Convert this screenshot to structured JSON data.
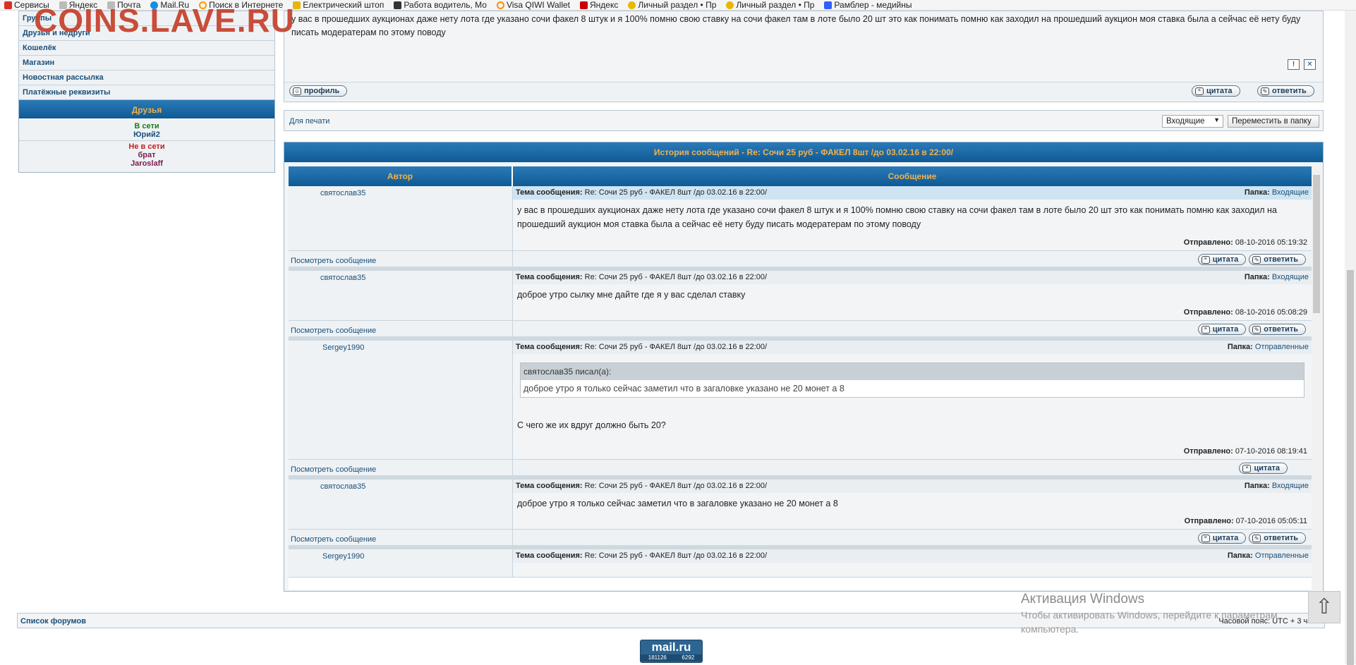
{
  "bookmarks": [
    {
      "label": "Сервисы",
      "icon": "apps-grid-icon",
      "color": "#d93025"
    },
    {
      "label": "Яндекс",
      "icon": "page-icon",
      "color": "#bbbbbb"
    },
    {
      "label": "Почта",
      "icon": "page-icon",
      "color": "#bbbbbb"
    },
    {
      "label": "Mail.Ru",
      "icon": "mailru-icon",
      "color": "#168de2"
    },
    {
      "label": "Поиск в Интернете",
      "icon": "search-icon",
      "color": "#ff9900"
    },
    {
      "label": "Електрический штоп",
      "icon": "bookmark-icon",
      "color": "#e3b70c"
    },
    {
      "label": "Работа водитель, Мо",
      "icon": "rn-icon",
      "color": "#333333"
    },
    {
      "label": "Visa QIWI Wallet",
      "icon": "qiwi-icon",
      "color": "#ff8c00"
    },
    {
      "label": "Яндекс",
      "icon": "yandex-icon",
      "color": "#cc0000"
    },
    {
      "label": "Личный раздел • Пр",
      "icon": "smiley-icon",
      "color": "#e6b800"
    },
    {
      "label": "Личный раздел • Пр",
      "icon": "smiley-icon",
      "color": "#e6b800"
    },
    {
      "label": "Рамблер - медийны",
      "icon": "rambler-icon",
      "color": "#315efb"
    }
  ],
  "watermark": "COINS.LAVE.RU",
  "sidebar": {
    "items": [
      "Группы",
      "Друзья и недруги",
      "Кошелёк",
      "Магазин",
      "Новостная рассылка",
      "Платёжные реквизиты"
    ]
  },
  "friends": {
    "title": "Друзья",
    "online_label": "В сети",
    "online": [
      "Юрий2"
    ],
    "offline_label": "Не в сети",
    "offline": [
      "брат",
      "Jaroslaff"
    ]
  },
  "top_message": {
    "text": "у вас в прошедших аукционах даже нету лота где указано сочи факел 8 штук и я 100% помню свою ставку на сочи факел там в лоте было 20 шт это как понимать помню как заходил на прошедший аукцион моя ставка была а сейчас её нету буду писать модератерам по этому поводу",
    "report_icon": "!",
    "delete_icon": "✕",
    "profile_label": "профиль",
    "quote_label": "цитата",
    "reply_label": "ответить"
  },
  "printbar": {
    "print_label": "Для печати",
    "folder_select": "Входящие",
    "move_button": "Переместить в папку"
  },
  "history": {
    "title": "История сообщений - Re: Сочи 25 руб - ФАКЕЛ 8шт /до 03.02.16 в 22:00/",
    "col_author": "Автор",
    "col_message": "Сообщение",
    "subject_label": "Тема сообщения:",
    "folder_label": "Папка:",
    "sent_label": "Отправлено:",
    "view_label": "Посмотреть сообщение",
    "quote_label": "цитата",
    "reply_label": "ответить",
    "messages": [
      {
        "author": "святослав35",
        "subject": "Re: Сочи 25 руб - ФАКЕЛ 8шт /до 03.02.16 в 22:00/",
        "folder": "Входящие",
        "body": "у вас в прошедших аукционах даже нету лота где указано сочи факел 8 штук и я 100% помню свою ставку на сочи факел там в лоте было 20 шт это как понимать помню как заходил на прошедший аукцион моя ставка была а сейчас её нету буду писать модератерам по этому поводу",
        "sent": "08-10-2016 05:19:32"
      },
      {
        "author": "святослав35",
        "subject": "Re: Сочи 25 руб - ФАКЕЛ 8шт /до 03.02.16 в 22:00/",
        "folder": "Входящие",
        "body": "доброе утро сылку мне дайте где я у вас сделал ставку",
        "sent": "08-10-2016 05:08:29"
      },
      {
        "author": "Sergey1990",
        "subject": "Re: Сочи 25 руб - ФАКЕЛ 8шт /до 03.02.16 в 22:00/",
        "folder": "Отправленные",
        "quote_author": "святослав35 писал(а):",
        "quote_text": "доброе утро я только сейчас заметил что в загаловке указано не 20 монет а 8",
        "body": "С чего же их вдруг должно быть 20?",
        "sent": "07-10-2016 08:19:41"
      },
      {
        "author": "святослав35",
        "subject": "Re: Сочи 25 руб - ФАКЕЛ 8шт /до 03.02.16 в 22:00/",
        "folder": "Входящие",
        "body": "доброе утро я только сейчас заметил что в загаловке указано не 20 монет а 8",
        "sent": "07-10-2016 05:05:11"
      },
      {
        "author": "Sergey1990",
        "subject": "Re: Сочи 25 руб - ФАКЕЛ 8шт /до 03.02.16 в 22:00/",
        "folder": "Отправленные"
      }
    ]
  },
  "footer": {
    "forum_list": "Список форумов",
    "timezone": "Часовой пояс: UTC + 3 часа"
  },
  "windows_activation": {
    "title": "Активация Windows",
    "line1": "Чтобы активировать Windows, перейдите к параметрам",
    "line2": "компьютера."
  },
  "counter": {
    "brand": "mail.ru",
    "hits": "181126",
    "hosts": "6292"
  },
  "colors": {
    "header_blue": "#0f5a95",
    "header_text": "#f3b04a",
    "link": "#1a4f78"
  }
}
